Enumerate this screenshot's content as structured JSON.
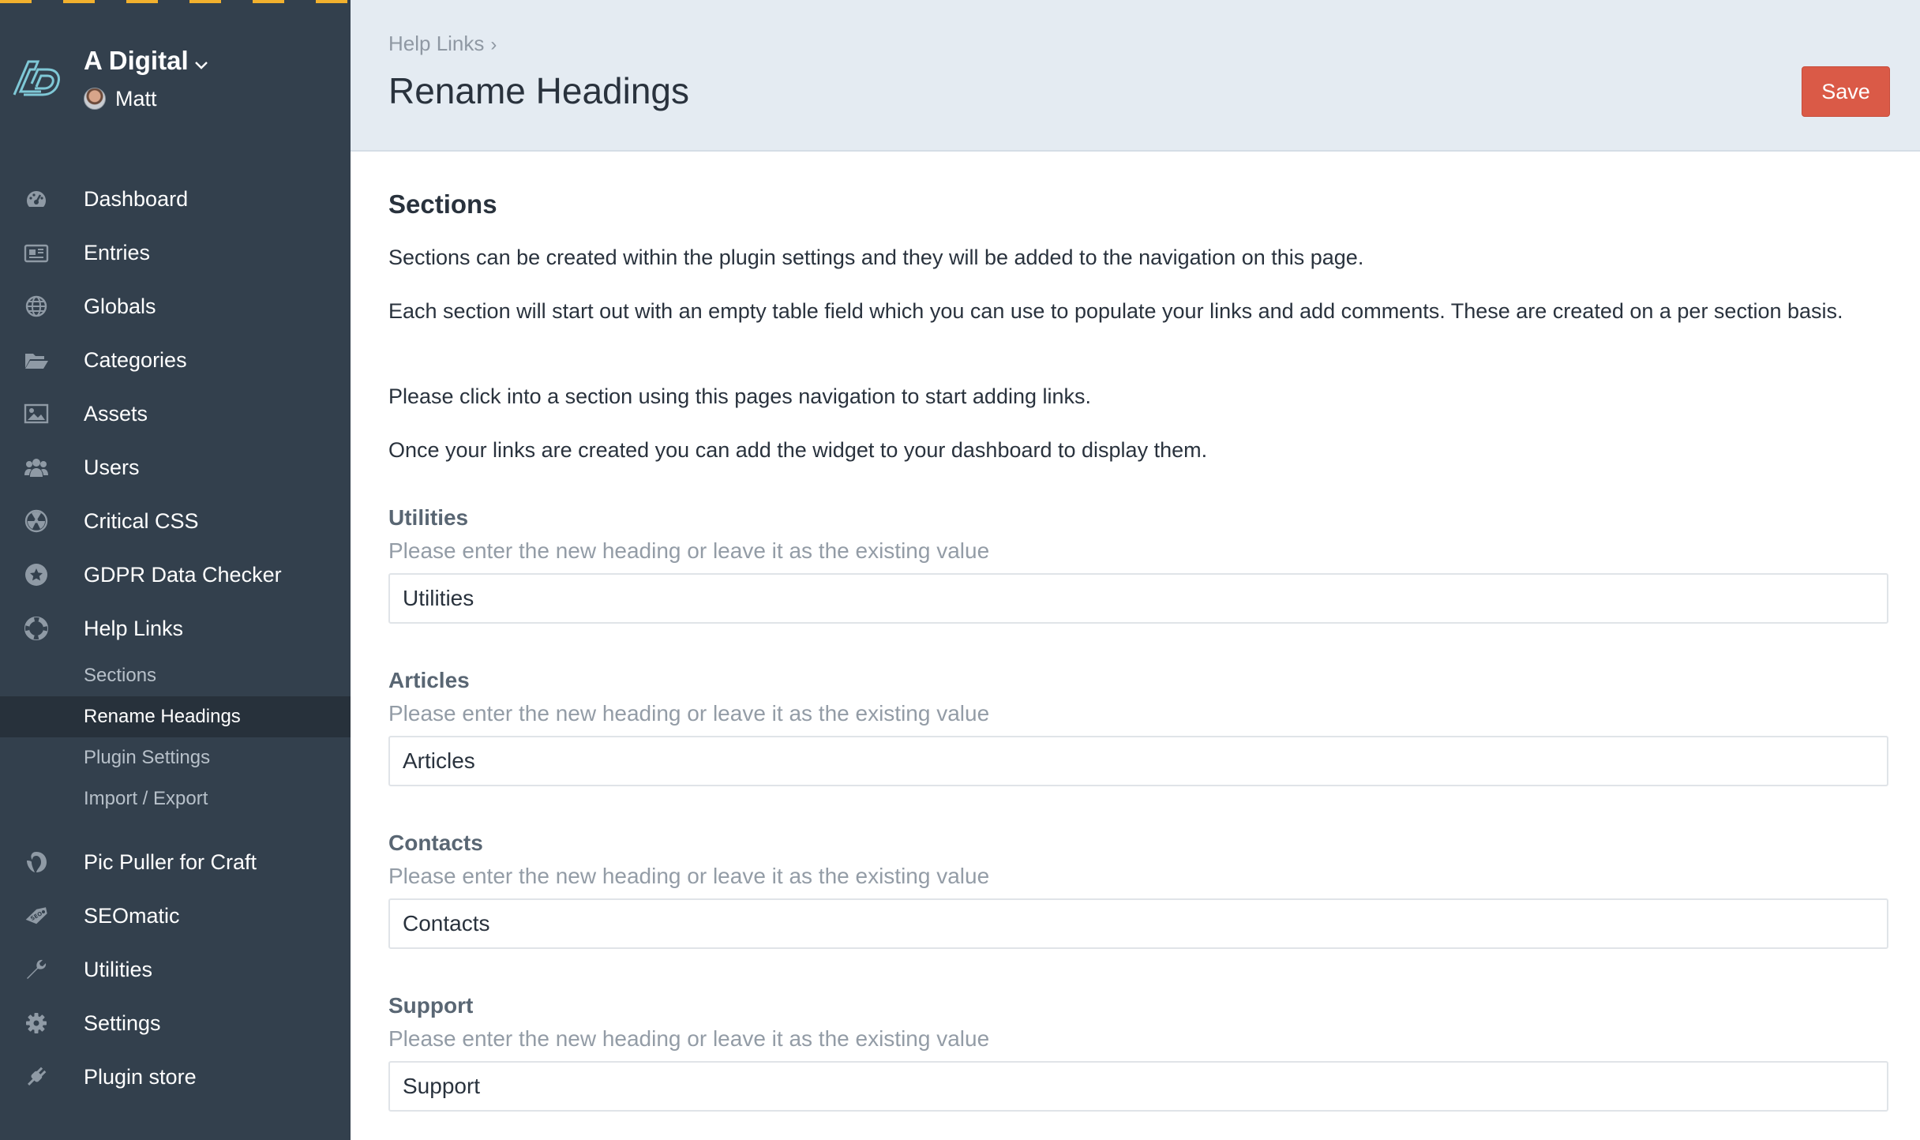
{
  "site": {
    "name": "A Digital",
    "user": "Matt"
  },
  "nav": {
    "items": [
      {
        "label": "Dashboard",
        "icon": "dashboard-icon"
      },
      {
        "label": "Entries",
        "icon": "entries-icon"
      },
      {
        "label": "Globals",
        "icon": "globe-icon"
      },
      {
        "label": "Categories",
        "icon": "folder-icon"
      },
      {
        "label": "Assets",
        "icon": "image-icon"
      },
      {
        "label": "Users",
        "icon": "users-icon"
      },
      {
        "label": "Critical CSS",
        "icon": "radiation-icon"
      },
      {
        "label": "GDPR Data Checker",
        "icon": "star-badge-icon"
      },
      {
        "label": "Help Links",
        "icon": "lifebuoy-icon"
      }
    ],
    "subitems": [
      {
        "label": "Sections"
      },
      {
        "label": "Rename Headings",
        "active": true
      },
      {
        "label": "Plugin Settings"
      },
      {
        "label": "Import / Export"
      }
    ],
    "items_lower": [
      {
        "label": "Pic Puller for Craft",
        "icon": "pic-puller-icon"
      },
      {
        "label": "SEOmatic",
        "icon": "seo-tag-icon"
      },
      {
        "label": "Utilities",
        "icon": "wrench-icon"
      },
      {
        "label": "Settings",
        "icon": "gear-icon"
      },
      {
        "label": "Plugin store",
        "icon": "plug-icon"
      }
    ]
  },
  "header": {
    "breadcrumb": "Help Links",
    "breadcrumb_sep": "›",
    "title": "Rename Headings",
    "save_label": "Save"
  },
  "main": {
    "heading": "Sections",
    "paragraphs": [
      "Sections can be created within the plugin settings and they will be added to the navigation on this page.",
      "Each section will start out with an empty table field which you can use to populate your links and add comments. These are created on a per section basis.",
      "Please click into a section using this pages navigation to start adding links.",
      "Once your links are created you can add the widget to your dashboard to display them."
    ],
    "fields": [
      {
        "label": "Utilities",
        "instructions": "Please enter the new heading or leave it as the existing value",
        "value": "Utilities"
      },
      {
        "label": "Articles",
        "instructions": "Please enter the new heading or leave it as the existing value",
        "value": "Articles"
      },
      {
        "label": "Contacts",
        "instructions": "Please enter the new heading or leave it as the existing value",
        "value": "Contacts"
      },
      {
        "label": "Support",
        "instructions": "Please enter the new heading or leave it as the existing value",
        "value": "Support"
      }
    ]
  },
  "colors": {
    "sidebar": "#33404d",
    "header": "#e4ebf2",
    "accent": "#da5a47",
    "warning_stripe": "#f2b12e"
  }
}
